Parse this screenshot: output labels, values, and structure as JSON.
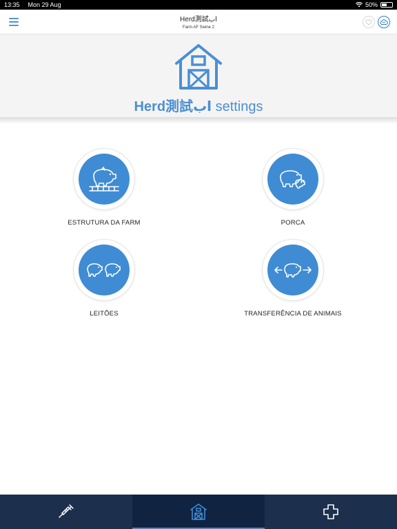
{
  "status_bar": {
    "time": "13:35",
    "date": "Mon 29 Aug",
    "battery": "50%",
    "battery_level": 0.5
  },
  "header": {
    "title": "Herd測試اب",
    "subtitle": "Farm AF Swine 2",
    "icons": [
      "menu-icon",
      "heart-icon",
      "cloud-sync-icon"
    ]
  },
  "hero": {
    "title_bold": "Herd測試اب",
    "title_rest": " settings",
    "icon": "barn-icon",
    "accent_color": "#4a8fd4"
  },
  "tiles": [
    {
      "label": "ESTRUTURA DA FARM",
      "icon": "pig-pen-icon"
    },
    {
      "label": "PORCA",
      "icon": "sow-piglets-icon"
    },
    {
      "label": "LEITÕES",
      "icon": "two-piglets-icon"
    },
    {
      "label": "TRANSFERÊNCIA DE ANIMAIS",
      "icon": "pig-transfer-icon"
    }
  ],
  "tab_bar": {
    "tabs": [
      {
        "icon": "syringe-icon",
        "active": false
      },
      {
        "icon": "barn-icon",
        "active": true
      },
      {
        "icon": "medical-cross-icon",
        "active": false
      }
    ],
    "background": "#1c2f4d"
  }
}
